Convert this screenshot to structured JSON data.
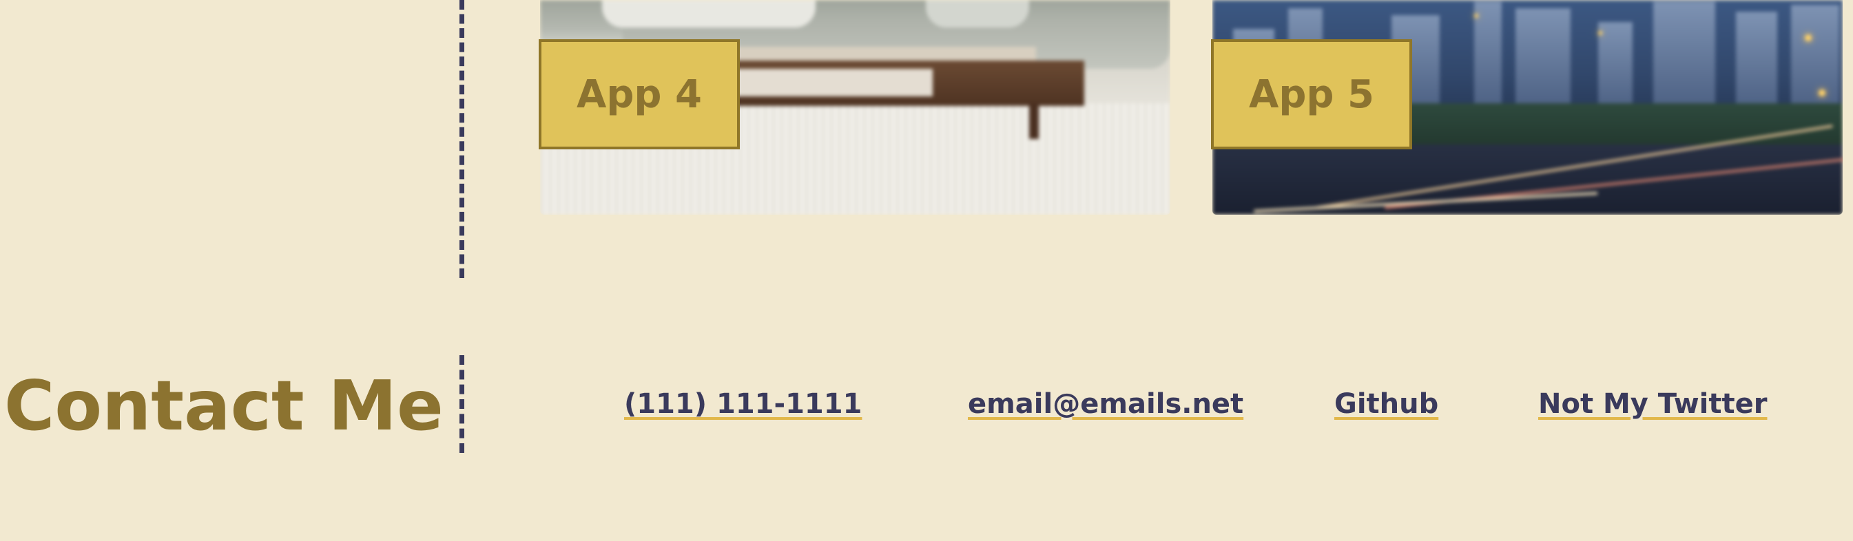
{
  "projects": {
    "items": [
      {
        "label": "App 4",
        "image": "living-room-photo"
      },
      {
        "label": "App 5",
        "image": "city-skyline-photo"
      }
    ]
  },
  "contact": {
    "title": "Contact Me",
    "links": {
      "phone": "(111) 111-1111",
      "email": "email@emails.net",
      "github": "Github",
      "twitter": "Not My Twitter"
    }
  },
  "colors": {
    "background": "#f2e9d0",
    "accent_gold": "#e0c35a",
    "title_olive": "#8c7330",
    "link_navy": "#3a3a5c",
    "underline": "#e2b84a"
  }
}
